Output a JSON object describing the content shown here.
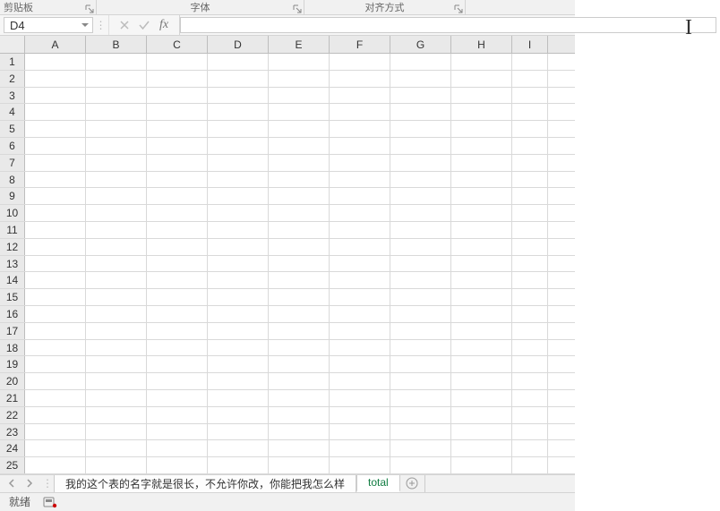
{
  "ribbon": {
    "group1": "剪贴板",
    "group2": "字体",
    "group3": "对齐方式"
  },
  "nameBox": {
    "value": "D4"
  },
  "formulaBar": {
    "cancel": "✕",
    "accept": "✓",
    "fx": "fx",
    "value": ""
  },
  "columns": [
    "A",
    "B",
    "C",
    "D",
    "E",
    "F",
    "G",
    "H",
    "I"
  ],
  "rowCount": 25,
  "sheetTabs": {
    "tab1": "我的这个表的名字就是很长，不允许你改，你能把我怎么样",
    "tab2": "total"
  },
  "status": {
    "ready": "就绪"
  }
}
